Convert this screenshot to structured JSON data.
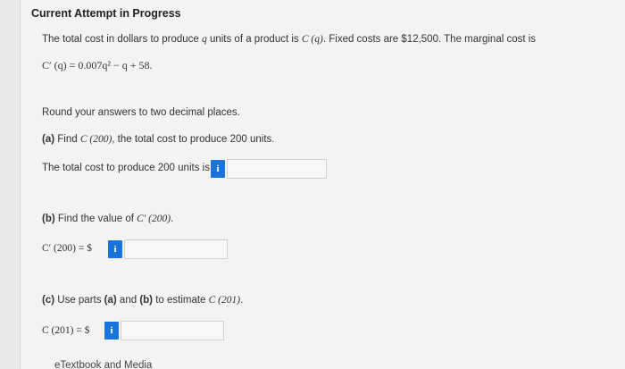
{
  "header": {
    "title": "Current Attempt in Progress"
  },
  "problem": {
    "intro": "The total cost in dollars to produce q units of a product is C (q). Fixed costs are $12,500. The marginal cost is",
    "intro_pre": "The total cost in dollars to produce ",
    "intro_q": "q",
    "intro_mid": " units of a product is ",
    "intro_cq": "C (q)",
    "intro_post": ". Fixed costs are $12,500. The marginal cost is",
    "marginal_cost_formula": "C′ (q) = 0.007q² − q + 58.",
    "instruction": "Round your answers to two decimal places."
  },
  "part_a": {
    "label": "(a)",
    "question_pre": " Find ",
    "question_math": "C (200)",
    "question_post": ", the total cost to produce 200 units.",
    "prompt": "The total cost to produce 200 units is $",
    "info_icon": "i",
    "input_value": ""
  },
  "part_b": {
    "label": "(b)",
    "question_pre": " Find the value of ",
    "question_math": "C′ (200)",
    "question_post": ".",
    "prompt_math": "C′ (200) = $",
    "info_icon": "i",
    "input_value": ""
  },
  "part_c": {
    "label": "(c)",
    "question_pre": " Use parts ",
    "ref_a": "(a)",
    "question_and": " and ",
    "ref_b": "(b)",
    "question_post": " to estimate ",
    "question_math": "C (201)",
    "question_end": ".",
    "prompt_math": "C (201) = $",
    "info_icon": "i",
    "input_value": ""
  },
  "footer": {
    "link": "eTextbook and Media"
  },
  "colors": {
    "info_button": "#1a73d9",
    "background": "#f3f3f2"
  }
}
